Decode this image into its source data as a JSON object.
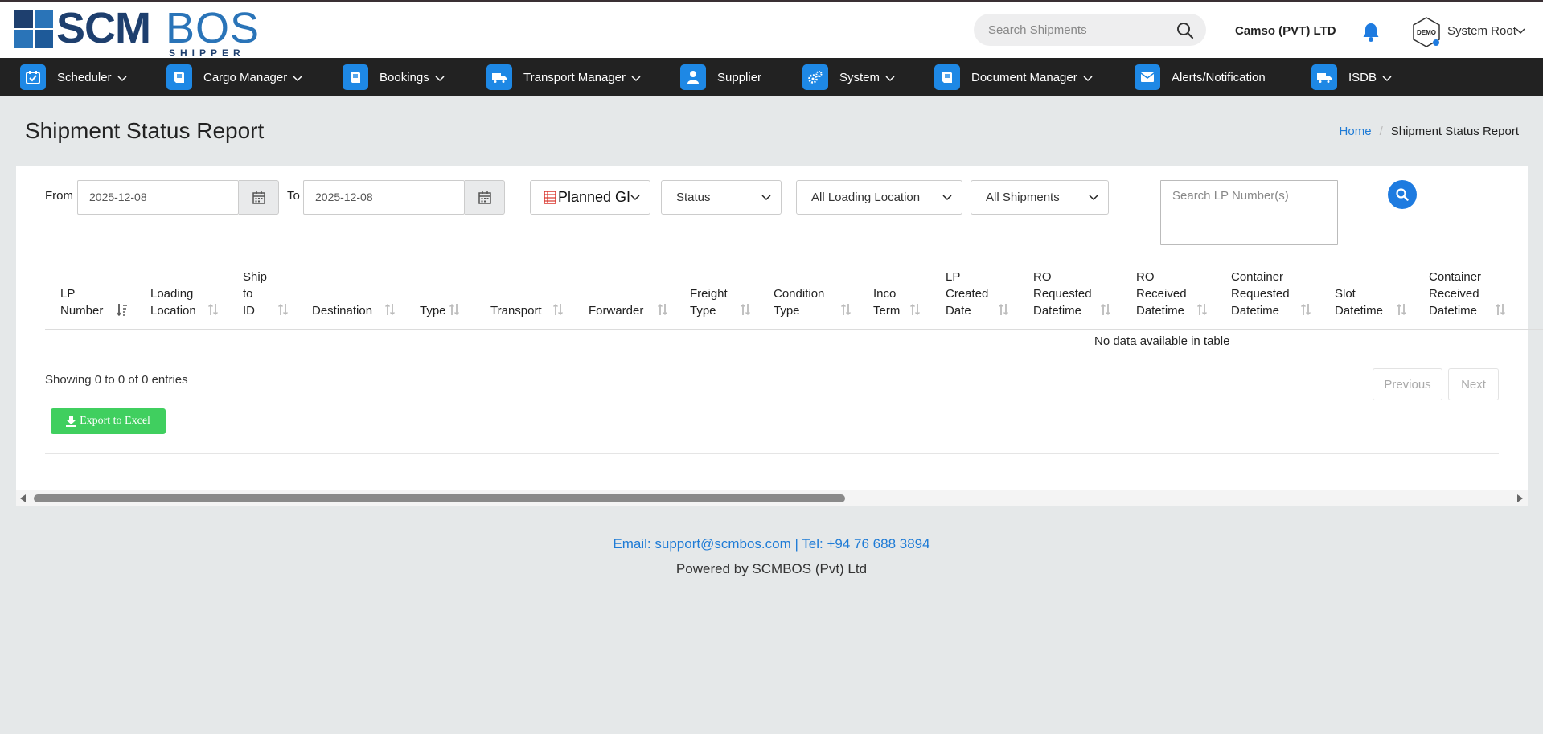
{
  "header": {
    "logo": {
      "text_scm": "SCM",
      "text_bos": "BOS",
      "text_sub": "SHIPPER"
    },
    "search": {
      "placeholder": "Search Shipments"
    },
    "company": "Camso (PVT) LTD",
    "avatar_text": "DEMO",
    "user": "System Root"
  },
  "nav": [
    {
      "label": "Scheduler",
      "icon": "calendar-icon",
      "dropdown": true
    },
    {
      "label": "Cargo Manager",
      "icon": "book-icon",
      "dropdown": true
    },
    {
      "label": "Bookings",
      "icon": "book-icon",
      "dropdown": true
    },
    {
      "label": "Transport Manager",
      "icon": "truck-icon",
      "dropdown": true
    },
    {
      "label": "Supplier",
      "icon": "user-icon",
      "dropdown": false
    },
    {
      "label": "System",
      "icon": "gears-icon",
      "dropdown": true
    },
    {
      "label": "Document Manager",
      "icon": "book-icon",
      "dropdown": true
    },
    {
      "label": "Alerts/Notification",
      "icon": "envelope-icon",
      "dropdown": false
    },
    {
      "label": "ISDB",
      "icon": "truck-icon",
      "dropdown": true
    }
  ],
  "page": {
    "title": "Shipment Status Report",
    "breadcrumb": {
      "home": "Home",
      "sep": "/",
      "current": "Shipment Status Report"
    }
  },
  "filters": {
    "from_label": "From",
    "from_value": "2025-12-08",
    "to_label": "To",
    "to_value": "2025-12-08",
    "date_type": "Planned GI",
    "status": "Status",
    "loading_location": "All Loading Location",
    "shipments": "All Shipments",
    "lp_search_placeholder": "Search LP Number(s)"
  },
  "table": {
    "columns": [
      [
        "LP",
        "Number"
      ],
      [
        "Loading",
        "Location"
      ],
      [
        "Ship",
        "to",
        "ID"
      ],
      [
        "Destination"
      ],
      [
        "Type"
      ],
      [
        "Transport"
      ],
      [
        "Forwarder"
      ],
      [
        "Freight",
        "Type"
      ],
      [
        "Condition",
        "Type"
      ],
      [
        "Inco",
        "Term"
      ],
      [
        "LP",
        "Created",
        "Date"
      ],
      [
        "RO",
        "Requested",
        "Datetime"
      ],
      [
        "RO",
        "Received",
        "Datetime"
      ],
      [
        "Container",
        "Requested",
        "Datetime"
      ],
      [
        "Slot",
        "Datetime"
      ],
      [
        "Container",
        "Received",
        "Datetime"
      ]
    ],
    "empty_text": "No data available in table",
    "info": "Showing 0 to 0 of 0 entries",
    "previous": "Previous",
    "next": "Next",
    "export": "Export to Excel"
  },
  "footer": {
    "contact": "Email: support@scmbos.com | Tel: +94 76 688 3894",
    "powered": "Powered by SCMBOS (Pvt) Ltd"
  },
  "colors": {
    "accent": "#1e7be0",
    "nav_bg": "#222222",
    "export_green": "#40cf5f"
  }
}
